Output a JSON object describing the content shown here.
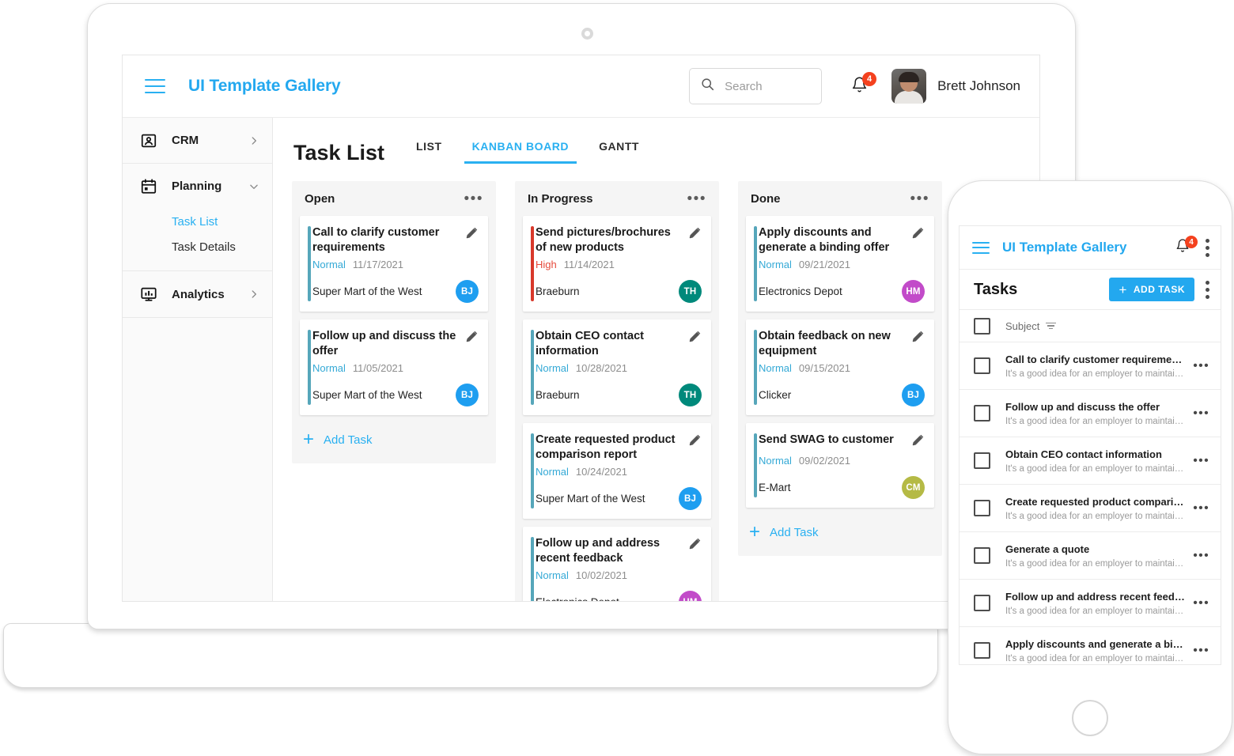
{
  "desktop": {
    "header": {
      "menu_icon": "hamburger-icon",
      "title": "UI Template Gallery",
      "search": {
        "placeholder": "Search",
        "value": "",
        "icon": "search-icon"
      },
      "notifications": {
        "icon": "bell-icon",
        "count": "4"
      },
      "user": {
        "name": "Brett Johnson",
        "avatar": "user-photo"
      }
    },
    "sidebar": {
      "groups": [
        {
          "label": "CRM",
          "icon": "contact-card-icon",
          "chevron": "chevron-right",
          "children": []
        },
        {
          "label": "Planning",
          "icon": "calendar-icon",
          "chevron": "chevron-down",
          "children": [
            {
              "label": "Task List",
              "active": true
            },
            {
              "label": "Task Details",
              "active": false
            }
          ]
        },
        {
          "label": "Analytics",
          "icon": "analytics-icon",
          "chevron": "chevron-right",
          "children": []
        }
      ]
    },
    "page": {
      "title": "Task List",
      "tabs": [
        {
          "label": "LIST",
          "active": false
        },
        {
          "label": "KANBAN BOARD",
          "active": true
        },
        {
          "label": "GANTT",
          "active": false
        }
      ],
      "add_task_label": "Add Task",
      "column_menu_icon": "more-horizontal-icon",
      "edit_icon": "pencil-icon",
      "columns": [
        {
          "title": "Open",
          "cards": [
            {
              "title": "Call to clarify customer requirements",
              "priority": "Normal",
              "priority_kind": "normal",
              "date": "11/17/2021",
              "account": "Super Mart of the West",
              "initials": "BJ",
              "chip_color": "#1e9ef0",
              "accent": "#56a6ba"
            },
            {
              "title": "Follow up and discuss the offer",
              "priority": "Normal",
              "priority_kind": "normal",
              "date": "11/05/2021",
              "account": "Super Mart of the West",
              "initials": "BJ",
              "chip_color": "#1e9ef0",
              "accent": "#56a6ba"
            }
          ]
        },
        {
          "title": "In Progress",
          "cards": [
            {
              "title": "Send pictures/brochures of new products",
              "priority": "High",
              "priority_kind": "high",
              "date": "11/14/2021",
              "account": "Braeburn",
              "initials": "TH",
              "chip_color": "#00897b",
              "accent": "#d8392b"
            },
            {
              "title": "Obtain CEO contact information",
              "priority": "Normal",
              "priority_kind": "normal",
              "date": "10/28/2021",
              "account": "Braeburn",
              "initials": "TH",
              "chip_color": "#00897b",
              "accent": "#56a6ba"
            },
            {
              "title": "Create requested product comparison report",
              "priority": "Normal",
              "priority_kind": "normal",
              "date": "10/24/2021",
              "account": "Super Mart of the West",
              "initials": "BJ",
              "chip_color": "#1e9ef0",
              "accent": "#56a6ba"
            },
            {
              "title": "Follow up and address recent feedback",
              "priority": "Normal",
              "priority_kind": "normal",
              "date": "10/02/2021",
              "account": "Electronics Depot",
              "initials": "HM",
              "chip_color": "#c24bc9",
              "accent": "#56a6ba"
            }
          ]
        },
        {
          "title": "Done",
          "cards": [
            {
              "title": "Apply discounts and generate a binding offer",
              "priority": "Normal",
              "priority_kind": "normal",
              "date": "09/21/2021",
              "account": "Electronics Depot",
              "initials": "HM",
              "chip_color": "#c24bc9",
              "accent": "#56a6ba"
            },
            {
              "title": "Obtain feedback on new equipment",
              "priority": "Normal",
              "priority_kind": "normal",
              "date": "09/15/2021",
              "account": "Clicker",
              "initials": "BJ",
              "chip_color": "#1e9ef0",
              "accent": "#56a6ba"
            },
            {
              "title": "Send SWAG to customer",
              "priority": "Normal",
              "priority_kind": "normal",
              "date": "09/02/2021",
              "account": "E-Mart",
              "initials": "CM",
              "chip_color": "#b5ba45",
              "accent": "#56a6ba"
            }
          ]
        }
      ]
    }
  },
  "phone": {
    "header": {
      "menu_icon": "hamburger-icon",
      "title": "UI Template Gallery",
      "notifications": {
        "icon": "bell-icon",
        "count": "4"
      },
      "overflow_icon": "more-vertical-icon"
    },
    "toolbar": {
      "title": "Tasks",
      "add_label": "ADD TASK",
      "add_icon": "plus-icon",
      "overflow_icon": "more-vertical-icon"
    },
    "list_header": {
      "checkbox": "select-all",
      "column": "Subject",
      "sort_icon": "sort-icon"
    },
    "row_menu_icon": "more-horizontal-icon",
    "rows": [
      {
        "subject": "Call to clarify customer requirements",
        "description": "It's a good idea for an employer to maintain..."
      },
      {
        "subject": "Follow up and discuss the offer",
        "description": "It's a good idea for an employer to maintain..."
      },
      {
        "subject": "Obtain CEO contact information",
        "description": "It's a good idea for an employer to maintain..."
      },
      {
        "subject": "Create requested product comparison report",
        "description": "It's a good idea for an employer to maintain..."
      },
      {
        "subject": "Generate a quote",
        "description": "It's a good idea for an employer to maintain..."
      },
      {
        "subject": "Follow up and address recent feedback",
        "description": "It's a good idea for an employer to maintain..."
      },
      {
        "subject": "Apply discounts and generate a binding offer",
        "description": "It's a good idea for an employer to maintain..."
      }
    ]
  }
}
